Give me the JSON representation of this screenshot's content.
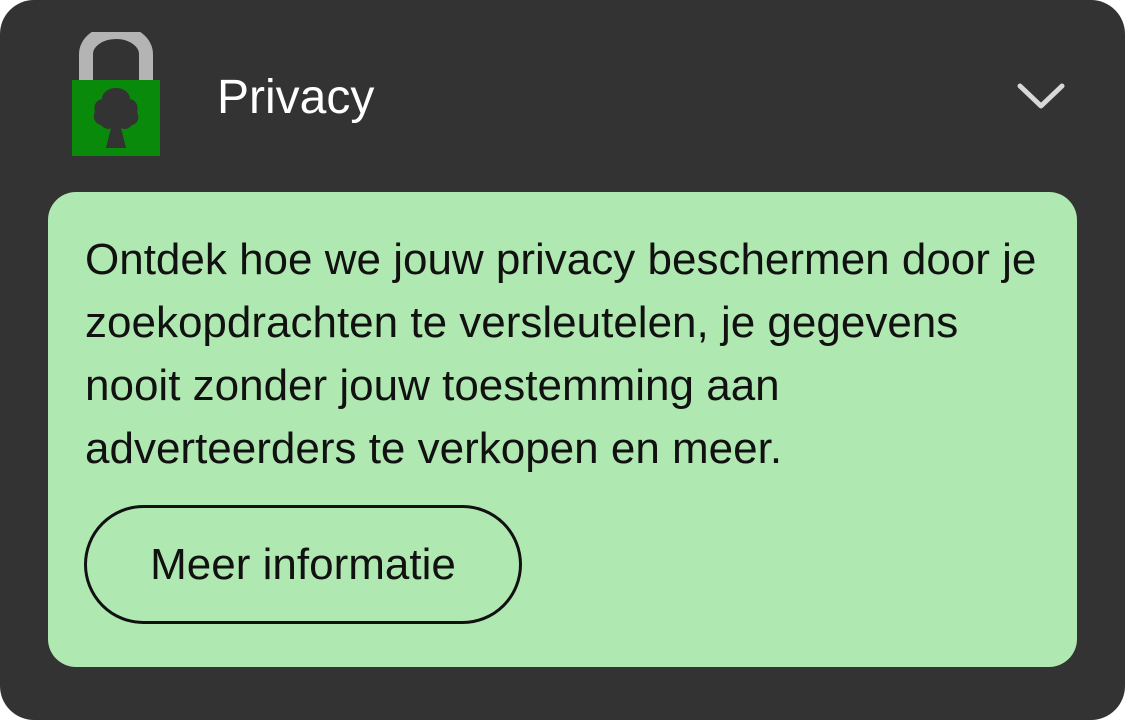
{
  "header": {
    "title": "Privacy",
    "icon": "lock-tree-icon",
    "toggle_icon": "chevron-down-icon"
  },
  "panel": {
    "description": "Ontdek hoe we jouw privacy beschermen door je zoekopdrachten te versleutelen, je gegevens nooit zonder jouw toestemming aan adverteerders te verkopen en meer.",
    "button_label": "Meer informatie"
  },
  "colors": {
    "card_background": "#333333",
    "panel_background": "#b0e8b1",
    "lock_body": "#0a8a0a",
    "lock_shackle": "#b4b4b4",
    "text_dark": "#111111",
    "text_light": "#ffffff"
  }
}
